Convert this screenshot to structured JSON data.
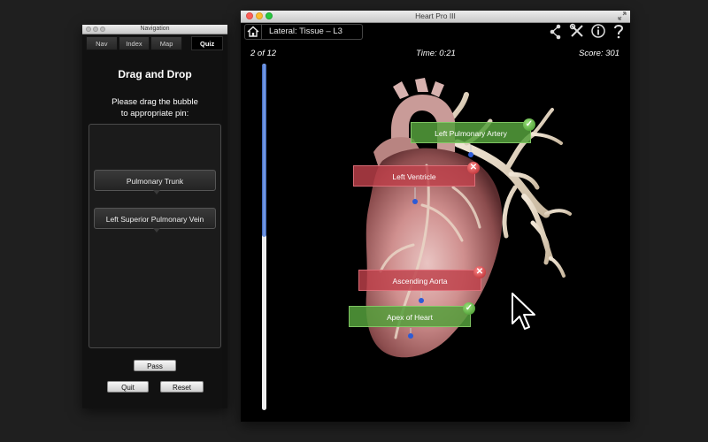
{
  "nav_window": {
    "title": "Navigation",
    "tabs": [
      {
        "label": "Nav"
      },
      {
        "label": "Index"
      },
      {
        "label": "Map"
      },
      {
        "label": "Quiz"
      }
    ],
    "heading": "Drag and Drop",
    "instruction_line1": "Please drag the bubble",
    "instruction_line2": "to appropriate pin:",
    "bubbles": [
      {
        "label": "Pulmonary Trunk"
      },
      {
        "label": "Left Superior Pulmonary Vein"
      }
    ],
    "pass_label": "Pass",
    "quit_label": "Quit",
    "reset_label": "Reset"
  },
  "main_window": {
    "title": "Heart Pro III",
    "breadcrumb": "Lateral: Tissue – L3",
    "toolbar_icons": [
      "share-icon",
      "tools-icon",
      "info-icon",
      "help-icon"
    ],
    "progress_text": "2 of 12",
    "progress_fraction": 0.5,
    "time_text": "Time: 0:21",
    "score_text": "Score: 301",
    "labels": [
      {
        "text": "Left Pulmonary Artery",
        "status": "correct"
      },
      {
        "text": "Left Ventricle",
        "status": "wrong"
      },
      {
        "text": "Ascending Aorta",
        "status": "wrong"
      },
      {
        "text": "Apex of Heart",
        "status": "correct"
      }
    ]
  },
  "colors": {
    "correct": "#55a03c",
    "wrong": "#be414b",
    "progress": "#3a63b8",
    "traffic_close": "#fc5f57",
    "traffic_min": "#fdbc2e",
    "traffic_max": "#28c840"
  }
}
